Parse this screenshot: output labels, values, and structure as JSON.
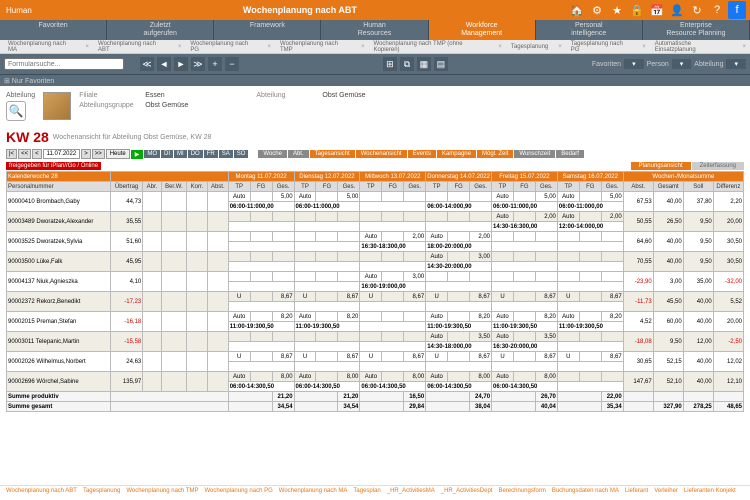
{
  "top": {
    "title": "Wochenplanung nach ABT",
    "icons": [
      "home",
      "gear",
      "star",
      "lock",
      "calendar",
      "person",
      "refresh",
      "help",
      "facebook"
    ]
  },
  "menu": [
    {
      "l1": "Favoriten"
    },
    {
      "l1": "Zuletzt",
      "l2": "aufgerufen"
    },
    {
      "l1": "Framework"
    },
    {
      "l1": "Human",
      "l2": "Resources"
    },
    {
      "l1": "Workforce",
      "l2": "Management",
      "active": true
    },
    {
      "l1": "Personal",
      "l2": "intelligence"
    },
    {
      "l1": "Enterprise",
      "l2": "Resource Planning"
    }
  ],
  "tabs": [
    "Wochenplanung nach MA",
    "Wochenplanung nach ABT",
    "Wochenplanung nach PG",
    "Wochenplanung nach TMP",
    "Wochenplanung nach TMP (ohne Kopieren)",
    "Tagesplanung",
    "Tagesplanung nach PG",
    "Automatische Einsatzplanung"
  ],
  "search_placeholder": "Formularsuche...",
  "nav_icons": [
    "≪",
    "<",
    "◄",
    "►",
    ">",
    "≫",
    "+",
    "−",
    "⊞",
    "⧉",
    "⎙"
  ],
  "toolbar": {
    "favoriten_lbl": "Favoriten",
    "person_lbl": "Person",
    "abteilung_lbl": "Abteilung"
  },
  "fav_bar": "⊞ Nur Favoriten",
  "filter": {
    "abteilung": "Abteilung",
    "filiale_k": "Filiale",
    "filiale_v": "Essen",
    "abtgrp_k": "Abteilungsgruppe",
    "abtgrp_v": "Obst Gemüse",
    "abt_k": "Abteilung",
    "abt_v": "Obst Gemüse"
  },
  "kw": {
    "title": "KW 28",
    "sub": "Wochenansicht für Abteilung Obst Gemüse, KW 28"
  },
  "ctrl": {
    "date": "11.07.2022",
    "heute": "Heute",
    "days": [
      "MO",
      "DI",
      "MI",
      "DO",
      "FR",
      "SA",
      "SO"
    ],
    "buttons": [
      "Woche",
      "Abt.",
      "Tagesansicht",
      "Wochenansicht",
      "Events",
      "Kampagne",
      "Mögl. Zeit",
      "Wunschzeit",
      "Bedarf"
    ]
  },
  "alert": "freigegeben für iPlan//Go / Online",
  "grid_tabs": [
    "Planungsansicht",
    "Zeiterfassung"
  ],
  "hdr": {
    "kw": "Kalenderwoche 28",
    "pn": "Personalnummer",
    "ueb": "Übertrag",
    "abr": "Abr.",
    "berw": "Ber.W.",
    "korr": "Korr.",
    "abst": "Abst.",
    "days": [
      "Montag 11.07.2022",
      "Dienstag 12.07.2022",
      "Mittwoch 13.07.2022",
      "Donnerstag 14.07.2022",
      "Freitag 15.07.2022",
      "Samstag 16.07.2022"
    ],
    "sub": [
      "TP",
      "FG",
      "Ges."
    ],
    "wm": "Wochen-/Monatsumme",
    "wm_sub": [
      "Abst.",
      "Gesamt",
      "Soll",
      "Differenz"
    ]
  },
  "rows": [
    {
      "pn": "90000410 Brombach,Gaby",
      "ueb": "44,73",
      "d": [
        [
          "Auto",
          "",
          "5,00"
        ],
        [
          "Auto",
          "",
          "5,00"
        ],
        [
          "",
          "",
          ""
        ],
        [
          "",
          "",
          ""
        ],
        [
          "Auto",
          "",
          "5,00"
        ],
        [
          "Auto",
          "",
          "5,00"
        ]
      ],
      "wm": [
        "67,53",
        "40,00",
        "37,80",
        "2,20"
      ],
      "t": [
        "06:00-11:000,00",
        "06:00-11:000,00",
        "",
        "06:00-14:000,90",
        "06:00-11:000,00",
        "06:00-11:000,00"
      ]
    },
    {
      "pn": "90003489 Dworatzek,Alexander",
      "ueb": "35,55",
      "d": [
        [
          "",
          "",
          ""
        ],
        [
          "",
          "",
          ""
        ],
        [
          "",
          "",
          ""
        ],
        [
          "",
          "",
          ""
        ],
        [
          "Auto",
          "",
          "2,00"
        ],
        [
          "Auto",
          "",
          "2,00"
        ]
      ],
      "wm": [
        "50,55",
        "26,50",
        "9,50",
        "20,00"
      ],
      "t": [
        "",
        "",
        "",
        "",
        "14:30-16:300,00",
        "12:00-14:000,00"
      ]
    },
    {
      "pn": "90003525 Dworatzek,Sylvia",
      "ueb": "51,60",
      "d": [
        [
          "",
          "",
          ""
        ],
        [
          "",
          "",
          ""
        ],
        [
          "Auto",
          "",
          "2,00"
        ],
        [
          "Auto",
          "",
          "2,00"
        ],
        [
          "",
          "",
          ""
        ],
        [
          "",
          "",
          ""
        ]
      ],
      "wm": [
        "64,60",
        "40,00",
        "9,50",
        "30,50"
      ],
      "t": [
        "",
        "",
        "16:30-18:300,00",
        "18:00-20:000,00",
        "",
        ""
      ]
    },
    {
      "pn": "90003500 Lüke,Falk",
      "ueb": "45,95",
      "d": [
        [
          "",
          "",
          ""
        ],
        [
          "",
          "",
          ""
        ],
        [
          "",
          "",
          ""
        ],
        [
          "Auto",
          "",
          "3,00"
        ],
        [
          "",
          "",
          ""
        ],
        [
          "",
          "",
          ""
        ]
      ],
      "wm": [
        "70,55",
        "40,00",
        "9,50",
        "30,50"
      ],
      "t": [
        "",
        "",
        "",
        "14:30-20:000,00",
        "",
        ""
      ]
    },
    {
      "pn": "90004137 Niuk,Agnieszka",
      "ueb": "4,10",
      "d": [
        [
          "",
          "",
          ""
        ],
        [
          "",
          "",
          ""
        ],
        [
          "Auto",
          "",
          "3,00"
        ],
        [
          "",
          "",
          ""
        ],
        [
          "",
          "",
          ""
        ],
        [
          "",
          "",
          ""
        ]
      ],
      "wm": [
        "-23,90",
        "3,00",
        "35,00",
        "-32,00"
      ],
      "t": [
        "",
        "",
        "16:00-19:000,00",
        "",
        "",
        ""
      ]
    },
    {
      "pn": "90002372 Rekorz,Benedikt",
      "ueb": "-17,23",
      "d": [
        [
          "U",
          "",
          "8,67"
        ],
        [
          "U",
          "",
          "8,67"
        ],
        [
          "U",
          "",
          "8,67"
        ],
        [
          "U",
          "",
          "8,67"
        ],
        [
          "U",
          "",
          "8,67"
        ],
        [
          "U",
          "",
          "8,67"
        ]
      ],
      "wm": [
        "-11,73",
        "45,50",
        "40,00",
        "5,52"
      ],
      "t": [
        "",
        "",
        "",
        "",
        "",
        ""
      ]
    },
    {
      "pn": "90002015 Preman,Stefan",
      "ueb": "-16,18",
      "d": [
        [
          "Auto",
          "",
          "8,20"
        ],
        [
          "Auto",
          "",
          "8,20"
        ],
        [
          "",
          "",
          ""
        ],
        [
          "Auto",
          "",
          "8,20"
        ],
        [
          "Auto",
          "",
          "8,20"
        ],
        [
          "Auto",
          "",
          "8,20"
        ]
      ],
      "wm": [
        "4,52",
        "60,00",
        "40,00",
        "20,00"
      ],
      "t": [
        "11:00-19:300,50",
        "11:00-19:300,50",
        "",
        "11:00-19:300,50",
        "11:00-19:300,50",
        "11:00-19:300,50"
      ]
    },
    {
      "pn": "90003011 Telepanic,Martin",
      "ueb": "-15,58",
      "d": [
        [
          "",
          "",
          ""
        ],
        [
          "",
          "",
          ""
        ],
        [
          "",
          "",
          ""
        ],
        [
          "Auto",
          "",
          "3,50"
        ],
        [
          "Auto",
          "",
          "3,50"
        ],
        [
          "",
          "",
          ""
        ]
      ],
      "wm": [
        "-18,08",
        "9,50",
        "12,00",
        "-2,50"
      ],
      "t": [
        "",
        "",
        "",
        "14:30-18:000,00",
        "16:30-20:000,00",
        ""
      ]
    },
    {
      "pn": "90002026 Wilhelmus,Norbert",
      "ueb": "24,63",
      "d": [
        [
          "U",
          "",
          "8,67"
        ],
        [
          "U",
          "",
          "8,67"
        ],
        [
          "U",
          "",
          "8,67"
        ],
        [
          "U",
          "",
          "8,67"
        ],
        [
          "U",
          "",
          "8,67"
        ],
        [
          "U",
          "",
          "8,67"
        ]
      ],
      "wm": [
        "30,65",
        "52,15",
        "40,00",
        "12,02"
      ],
      "t": [
        "",
        "",
        "",
        "",
        "",
        ""
      ]
    },
    {
      "pn": "90002696 Wörchel,Sabine",
      "ueb": "135,97",
      "d": [
        [
          "Auto",
          "",
          "8,00"
        ],
        [
          "Auto",
          "",
          "8,00"
        ],
        [
          "Auto",
          "",
          "8,00"
        ],
        [
          "Auto",
          "",
          "8,00"
        ],
        [
          "Auto",
          "",
          "8,00"
        ],
        [
          "",
          "",
          ""
        ]
      ],
      "wm": [
        "147,67",
        "52,10",
        "40,00",
        "12,10"
      ],
      "t": [
        "06:00-14:300,50",
        "06:00-14:300,50",
        "06:00-14:300,50",
        "06:00-14:300,50",
        "06:00-14:300,50",
        ""
      ]
    }
  ],
  "sum": {
    "prod_l": "Summe produktiv",
    "prod": [
      "21,20",
      "21,20",
      "16,50",
      "24,70",
      "26,70",
      "22,00"
    ],
    "ges_l": "Summe gesamt",
    "ges": [
      "34,54",
      "34,54",
      "29,84",
      "38,04",
      "40,04",
      "35,34"
    ],
    "tot": [
      "327,90",
      "278,25",
      "48,65"
    ]
  },
  "footer": [
    "Wochenplanung nach ABT",
    "Tagesplanung",
    "Wochenplanung nach TMP",
    "Wochenplanung nach PG",
    "Wochenplanung nach MA",
    "Tagesplan",
    "_HR_ActivitiesMA",
    "_HR_ActivitiesDept",
    "Berechnungsform",
    "Buchungsdaten nach MA",
    "Lieferant",
    "Verleiher",
    "Lieferanten Konjekt"
  ]
}
